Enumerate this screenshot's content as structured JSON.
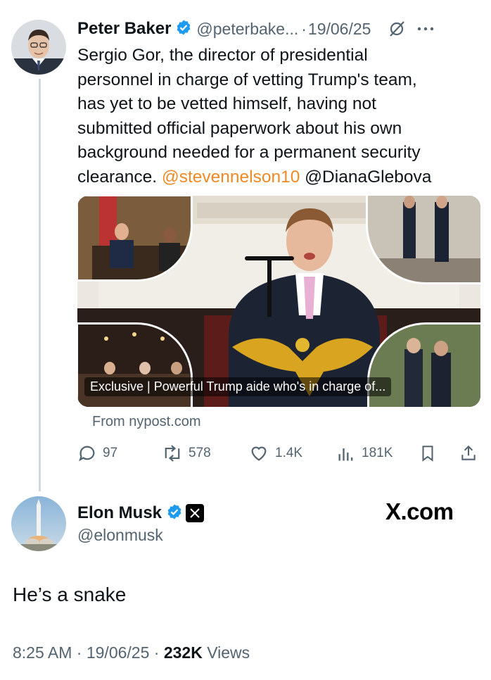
{
  "tweet": {
    "author_name": "Peter Baker",
    "handle": "@peterbake...",
    "separator": "·",
    "date": "19/06/25",
    "text_line1": "Sergio Gor, the director of presidential",
    "text_line2": "personnel in charge of vetting Trump's team,",
    "text_line3": "has yet to be vetted himself, having not",
    "text_line4": "submitted official paperwork about his own",
    "text_line5": "background needed for a permanent security",
    "text_prefix6": "clearance. ",
    "mention1": "@stevennelson10",
    "mention2": " @DianaGlebova",
    "card_title": "Exclusive | Powerful Trump aide who's in charge of...",
    "card_source": "From nypost.com",
    "replies": "97",
    "reposts": "578",
    "likes": "1.4K",
    "views": "181K"
  },
  "reply": {
    "author_name": "Elon Musk",
    "handle": "@elonmusk",
    "brand": "X.com",
    "text": "He’s a snake",
    "time": "8:25 AM",
    "sep": " · ",
    "date": "19/06/25",
    "views_count": "232K",
    "views_label": " Views"
  },
  "colors": {
    "verified_blue": "#1d9bf0",
    "link_orange": "#f08a24",
    "gray_text": "#536471"
  }
}
